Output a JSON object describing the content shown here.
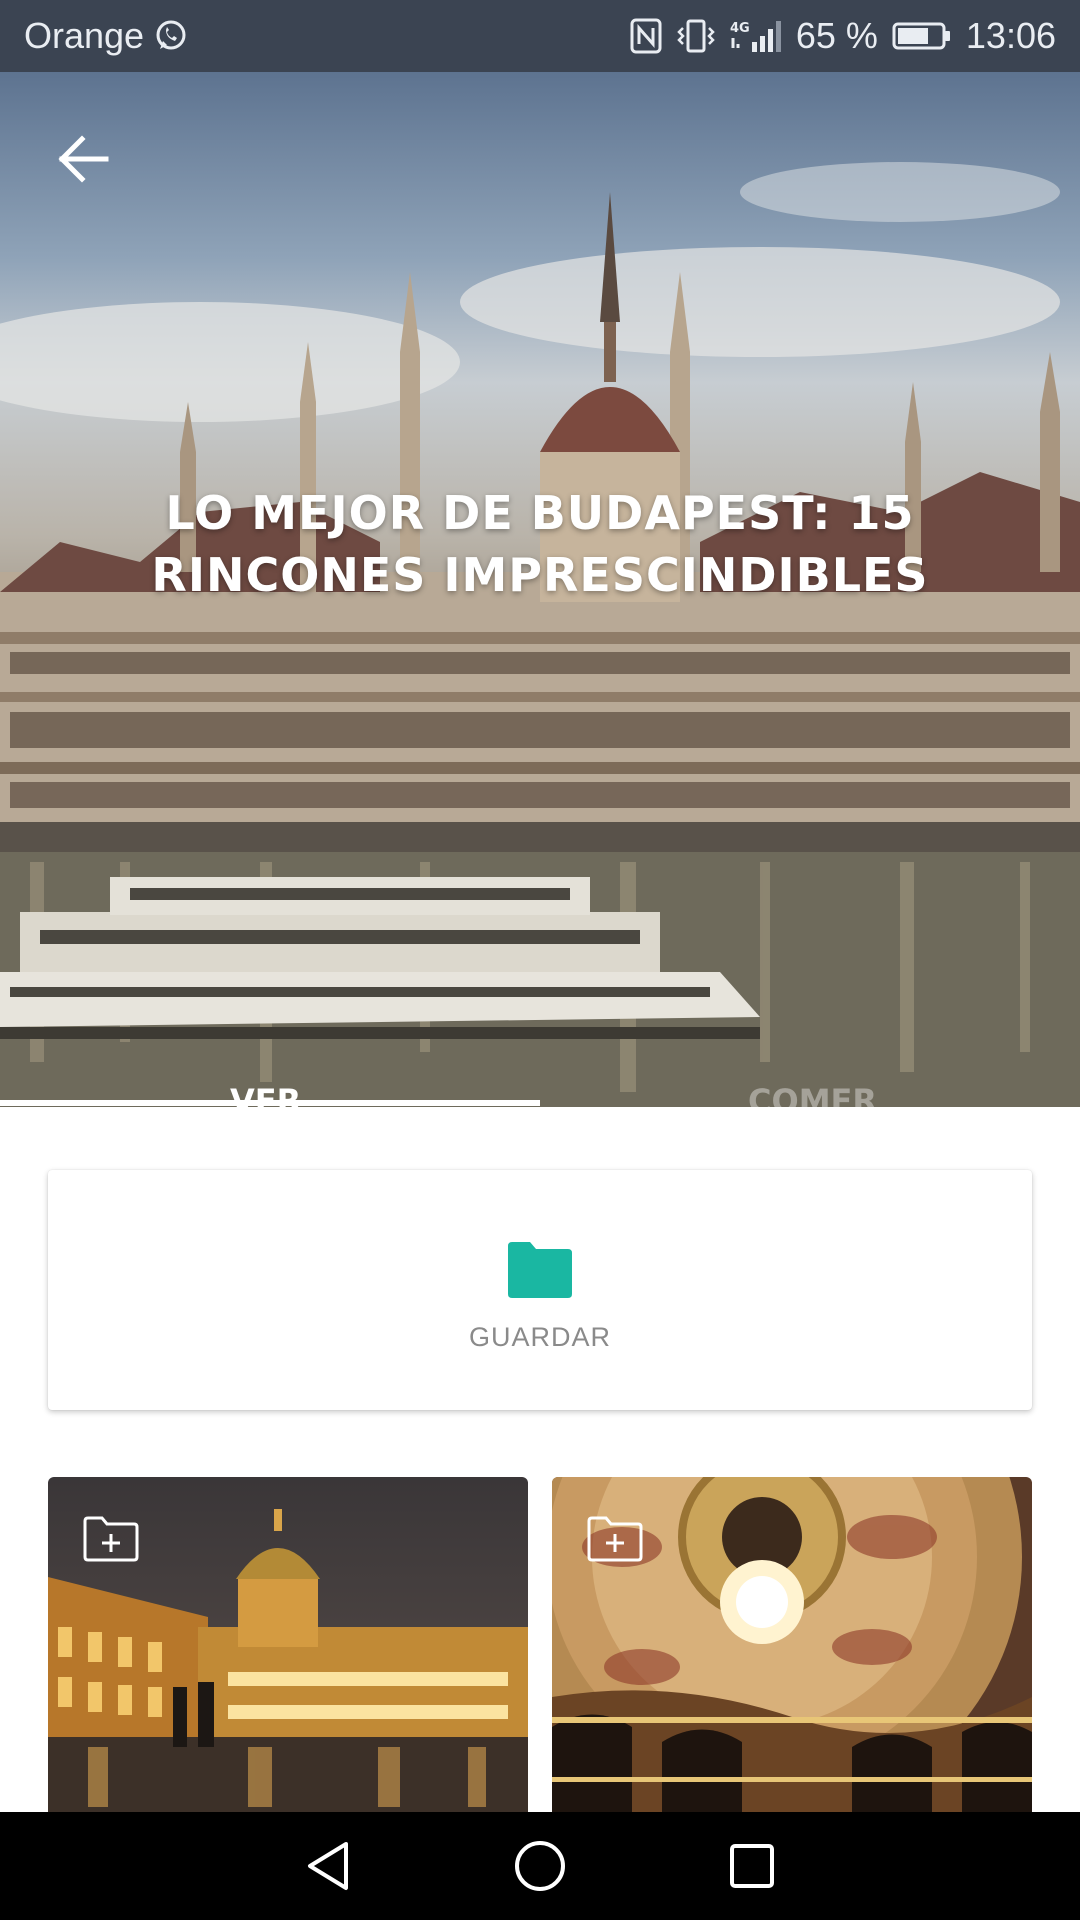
{
  "status_bar": {
    "carrier": "Orange",
    "battery_percent": "65 %",
    "time": "13:06",
    "icons": [
      "whatsapp-icon",
      "nfc-icon",
      "vibrate-icon",
      "signal-4g-icon",
      "battery-icon"
    ]
  },
  "hero": {
    "title": "LO MEJOR DE BUDAPEST: 15 RINCONES IMPRESCINDIBLES",
    "back_icon": "arrow-left-icon",
    "tabs": [
      {
        "label": "VER",
        "active": true
      },
      {
        "label": "COMER",
        "active": false
      }
    ]
  },
  "save_card": {
    "label": "GUARDAR",
    "icon": "folder-icon",
    "accent_color": "#1ab7a2"
  },
  "places": [
    {
      "image": "buda-castle-night-photo",
      "action_icon": "folder-add-icon"
    },
    {
      "image": "opera-house-ceiling-photo",
      "action_icon": "folder-add-icon"
    }
  ],
  "nav_bar": {
    "icons": [
      "back-triangle-icon",
      "home-circle-icon",
      "recents-square-icon"
    ]
  }
}
